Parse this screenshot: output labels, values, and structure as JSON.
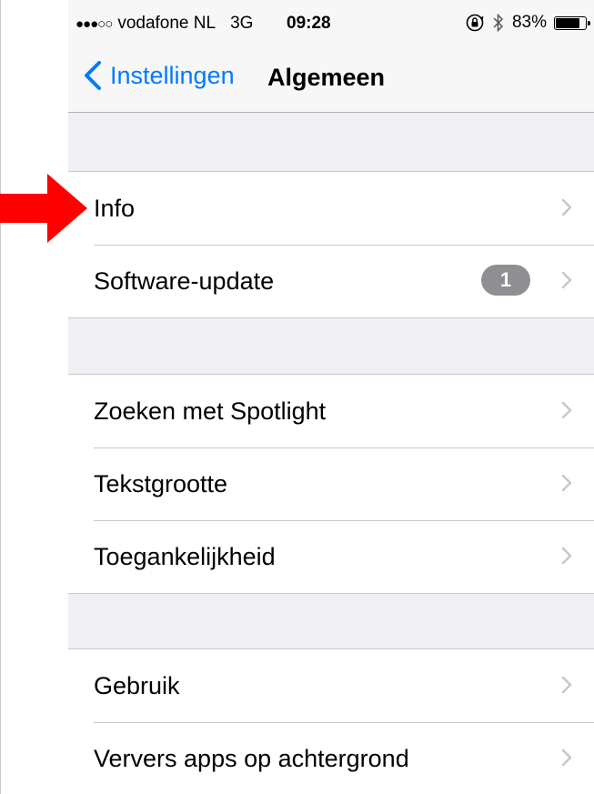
{
  "status_bar": {
    "signal": "●●●○○",
    "carrier": "vodafone NL",
    "network": "3G",
    "time": "09:28",
    "battery_text": "83%",
    "battery_level": 0.83
  },
  "nav": {
    "back_label": "Instellingen",
    "title": "Algemeen"
  },
  "groups": [
    {
      "cells": [
        {
          "label": "Info"
        },
        {
          "label": "Software-update",
          "badge": "1"
        }
      ]
    },
    {
      "cells": [
        {
          "label": "Zoeken met Spotlight"
        },
        {
          "label": "Tekstgrootte"
        },
        {
          "label": "Toegankelijkheid"
        }
      ]
    },
    {
      "cells": [
        {
          "label": "Gebruik"
        },
        {
          "label": "Ververs apps op achtergrond"
        }
      ]
    }
  ],
  "colors": {
    "accent": "#007aff",
    "arrow": "#ff0000",
    "badge": "#8e8e93",
    "background": "#efeff4"
  },
  "annotations": {
    "arrow_target": "Info"
  }
}
